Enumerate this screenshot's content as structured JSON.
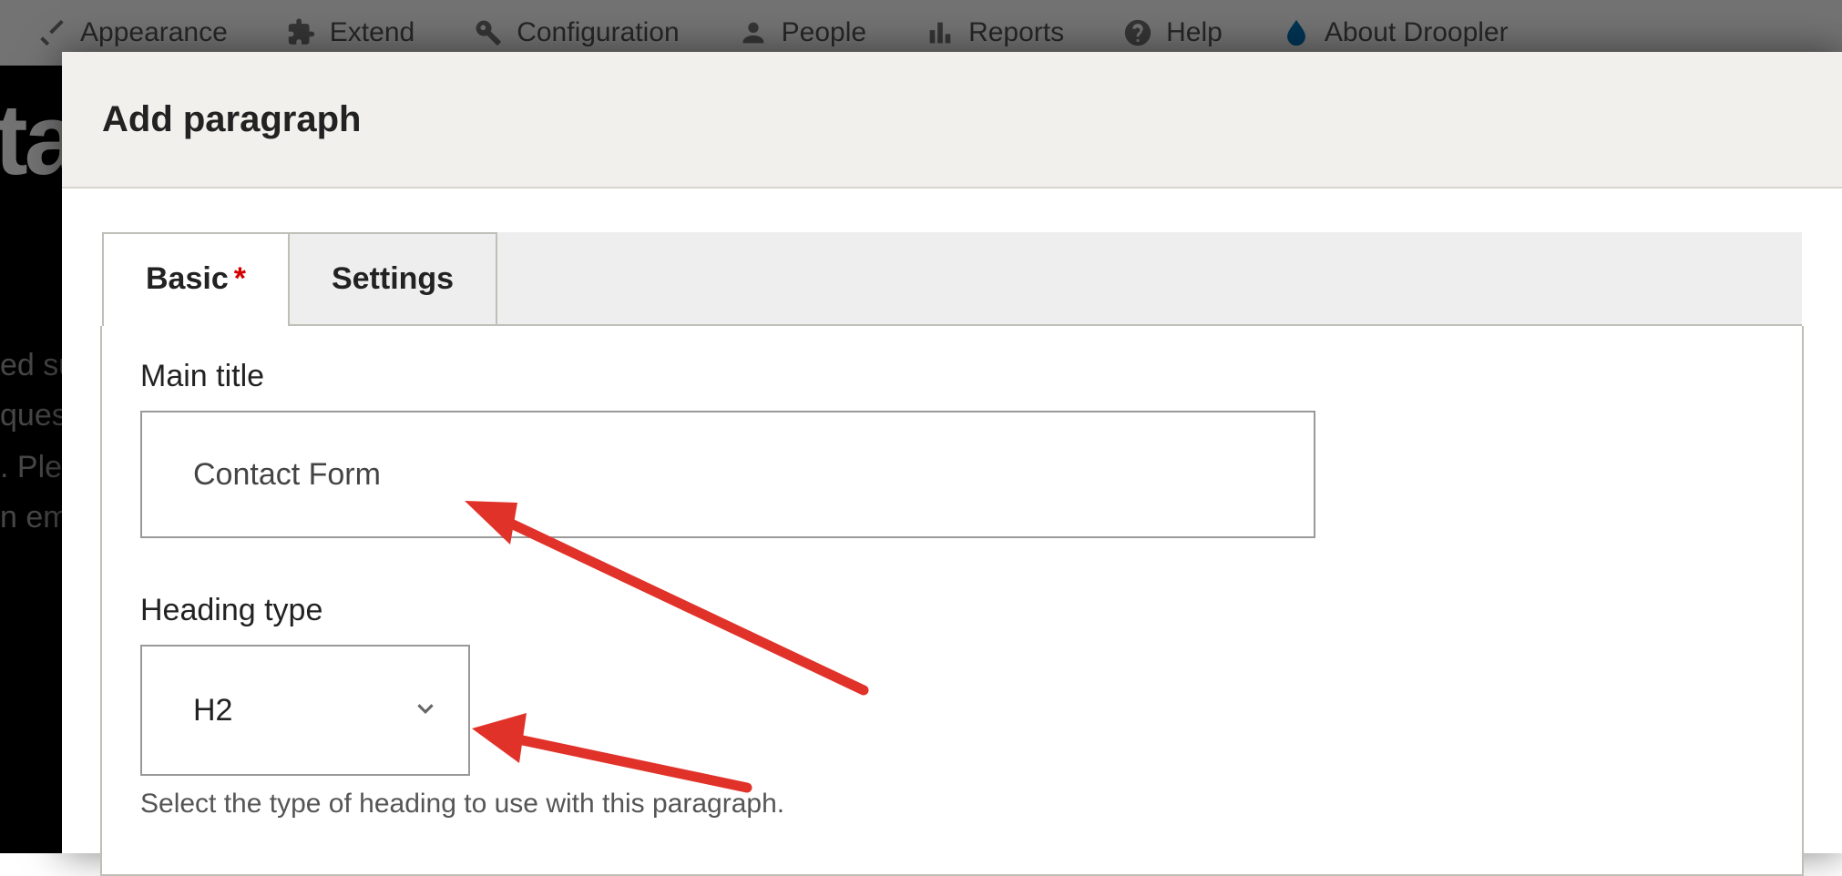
{
  "toolbar": {
    "items": [
      {
        "label": "Appearance"
      },
      {
        "label": "Extend"
      },
      {
        "label": "Configuration"
      },
      {
        "label": "People"
      },
      {
        "label": "Reports"
      },
      {
        "label": "Help"
      },
      {
        "label": "About Droopler"
      }
    ]
  },
  "background": {
    "logo_fragment": "ta",
    "lines": [
      "ed su",
      "ques",
      ". Ple",
      "n em"
    ]
  },
  "modal": {
    "title": "Add paragraph",
    "tabs": [
      {
        "label": "Basic",
        "required": true,
        "active": true
      },
      {
        "label": "Settings",
        "required": false,
        "active": false
      }
    ],
    "form": {
      "main_title": {
        "label": "Main title",
        "value": "Contact Form"
      },
      "heading_type": {
        "label": "Heading type",
        "value": "H2",
        "help": "Select the type of heading to use with this paragraph."
      }
    }
  }
}
